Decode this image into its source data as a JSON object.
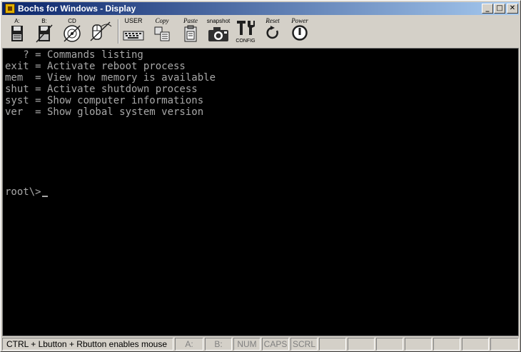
{
  "window": {
    "title": "Bochs for Windows - Display"
  },
  "titlebar_buttons": {
    "minimize": "_",
    "maximize": "□",
    "close": "✕"
  },
  "toolbar": {
    "floppy_a": "A:",
    "floppy_b": "B:",
    "cdrom": "CD",
    "mouse_icon": "mouse-icon",
    "user": "USER",
    "copy": "Copy",
    "paste": "Paste",
    "snapshot": "snapshot",
    "config": "CONFIG",
    "reset": "Reset",
    "power": "Power"
  },
  "console": {
    "lines": [
      "   ? = Commands listing",
      "exit = Activate reboot process",
      "mem  = View how memory is available",
      "shut = Activate shutdown process",
      "syst = Show computer informations",
      "ver  = Show global system version"
    ],
    "prompt": "root\\>"
  },
  "statusbar": {
    "message": "CTRL + Lbutton + Rbutton enables mouse",
    "a": "A:",
    "b": "B:",
    "num": "NUM",
    "caps": "CAPS",
    "scrl": "SCRL"
  }
}
